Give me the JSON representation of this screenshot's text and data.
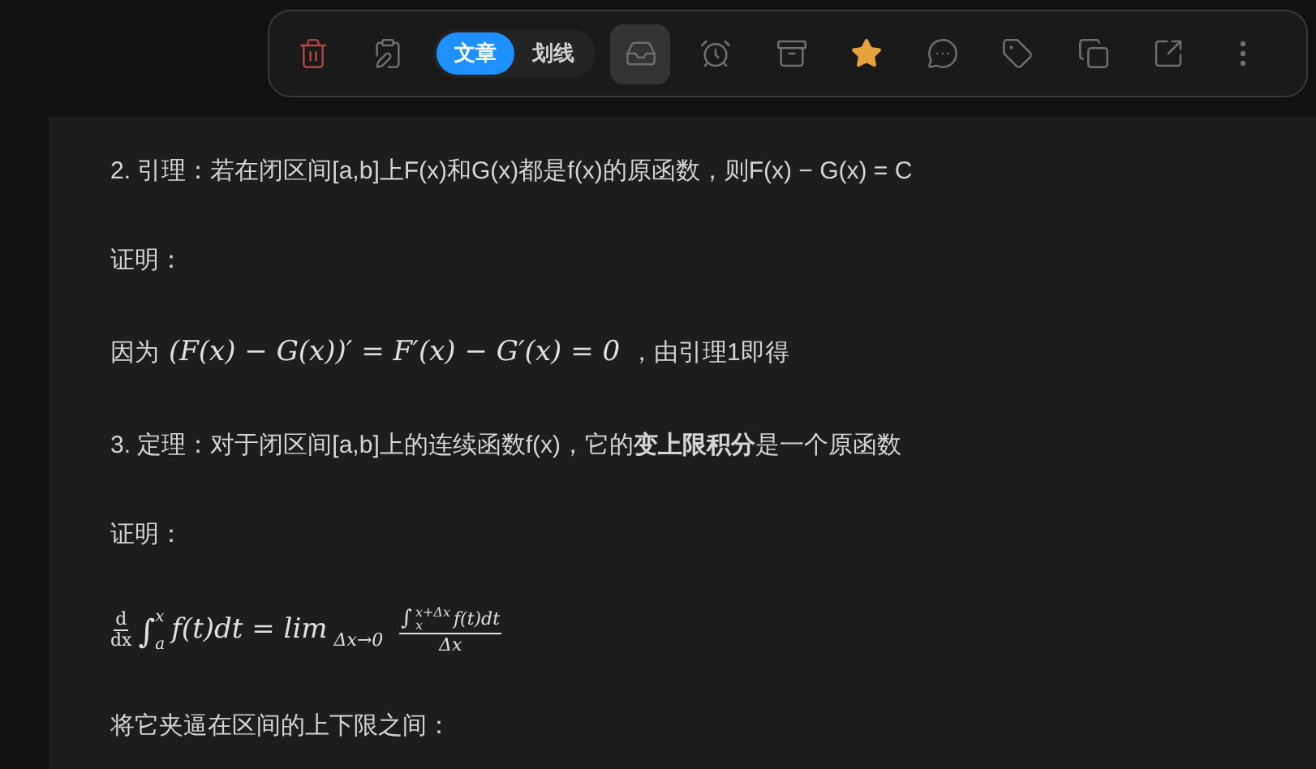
{
  "toolbar": {
    "buttons_left": [
      {
        "kind": "delete"
      },
      {
        "kind": "clipboard"
      }
    ],
    "tabs": [
      {
        "label": "文章",
        "selected": true
      },
      {
        "label": "划线",
        "selected": false
      }
    ],
    "buttons_right": [
      {
        "kind": "inbox",
        "selected": true
      },
      {
        "kind": "alarm",
        "selected": false
      },
      {
        "kind": "archive",
        "selected": false
      },
      {
        "kind": "star",
        "selected": true
      },
      {
        "kind": "comment",
        "selected": false
      },
      {
        "kind": "tag",
        "selected": false
      },
      {
        "kind": "copy",
        "selected": false
      },
      {
        "kind": "share",
        "selected": false
      },
      {
        "kind": "more",
        "selected": false
      }
    ]
  },
  "content": [
    {
      "kind": "text",
      "text": "2. 引理：若在闭区间[a,b]上F(x)和G(x)都是f(x)的原函数，则F(x) − G(x) = C"
    },
    {
      "kind": "text",
      "text": "证明："
    },
    {
      "kind": "inline_math",
      "before": "因为",
      "math": "(F(x) − G(x))′ = F′(x) − G′(x) = 0",
      "after": "，由引理1即得"
    },
    {
      "kind": "text",
      "text": "3. 定理：对于闭区间[a,b]上的连续函数f(x)，它的**变上限积分**是一个原函数"
    },
    {
      "kind": "text",
      "text": "证明："
    },
    {
      "kind": "formula",
      "d_num": "d",
      "d_den": "dx",
      "integral": "∫",
      "upper": "x",
      "lower": "a",
      "body": "f(t)dt = lim",
      "limit_sub": "Δx→0",
      "num_integral": "∫",
      "num_upper": "x+Δx",
      "num_lower": "x",
      "num_body": "f(t)dt",
      "den": "Δx"
    },
    {
      "kind": "text",
      "text": "将它夹逼在区间的上下限之间："
    }
  ]
}
